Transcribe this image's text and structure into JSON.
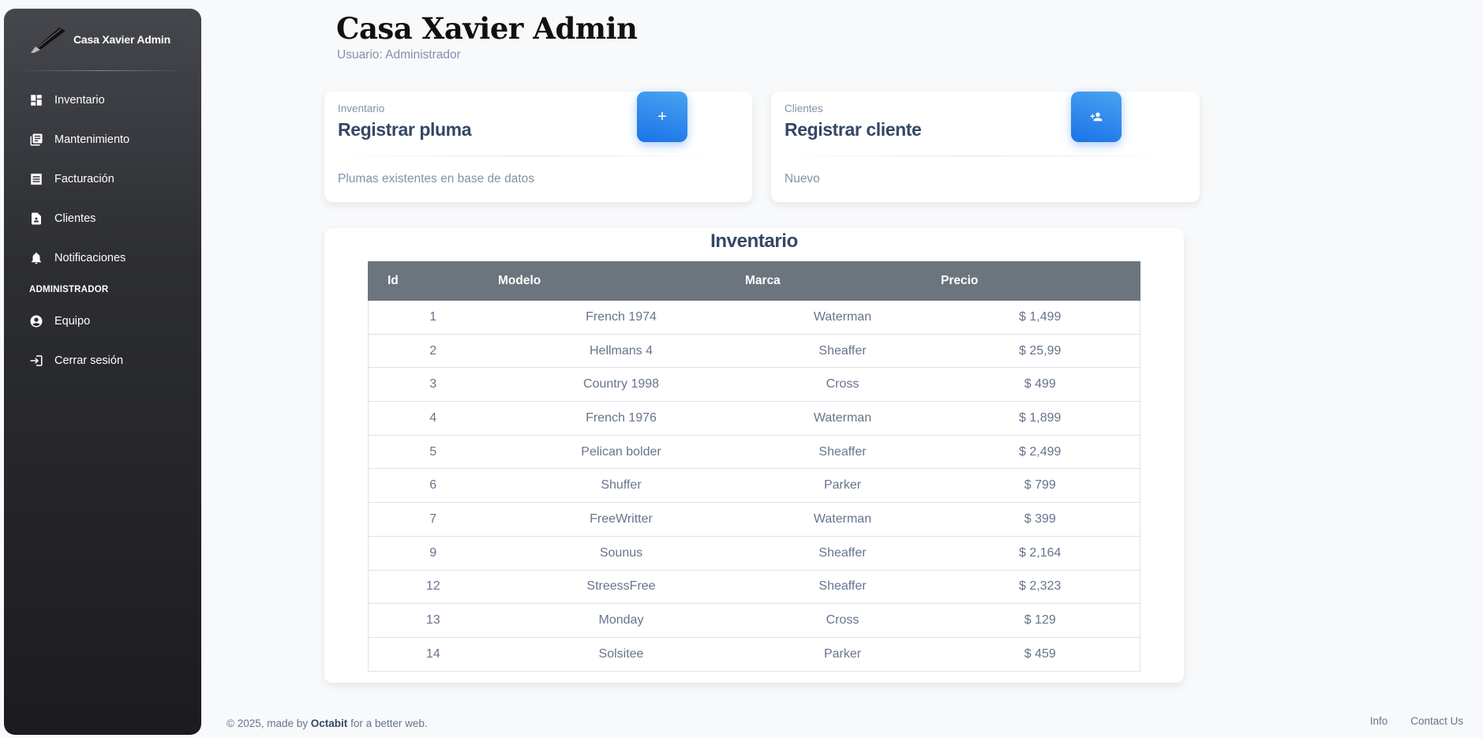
{
  "sidebar": {
    "brand": "Casa Xavier Admin",
    "items": [
      {
        "label": "Inventario",
        "icon": "dashboard-icon"
      },
      {
        "label": "Mantenimiento",
        "icon": "library-icon"
      },
      {
        "label": "Facturación",
        "icon": "receipt-icon"
      },
      {
        "label": "Clientes",
        "icon": "contact-page-icon"
      },
      {
        "label": "Notificaciones",
        "icon": "bell-icon"
      }
    ],
    "section": "ADMINISTRADOR",
    "admin_items": [
      {
        "label": "Equipo",
        "icon": "account-circle-icon"
      },
      {
        "label": "Cerrar sesión",
        "icon": "login-icon"
      }
    ]
  },
  "header": {
    "title": "Casa Xavier Admin",
    "subtitle": "Usuario: Administrador"
  },
  "cards": [
    {
      "label": "Inventario",
      "title": "Registrar pluma",
      "footer": "Plumas existentes en base de datos",
      "button_glyph": "+"
    },
    {
      "label": "Clientes",
      "title": "Registrar cliente",
      "footer": "Nuevo",
      "button_icon": "person-add-icon"
    }
  ],
  "inventory": {
    "title": "Inventario",
    "columns": [
      "Id",
      "Modelo",
      "Marca",
      "Precio"
    ],
    "rows": [
      [
        "1",
        "French 1974",
        "Waterman",
        "$ 1,499"
      ],
      [
        "2",
        "Hellmans 4",
        "Sheaffer",
        "$ 25,99"
      ],
      [
        "3",
        "Country 1998",
        "Cross",
        "$ 499"
      ],
      [
        "4",
        "French 1976",
        "Waterman",
        "$ 1,899"
      ],
      [
        "5",
        "Pelican bolder",
        "Sheaffer",
        "$ 2,499"
      ],
      [
        "6",
        "Shuffer",
        "Parker",
        "$ 799"
      ],
      [
        "7",
        "FreeWritter",
        "Waterman",
        "$ 399"
      ],
      [
        "9",
        "Sounus",
        "Sheaffer",
        "$ 2,164"
      ],
      [
        "12",
        "StreessFree",
        "Sheaffer",
        "$ 2,323"
      ],
      [
        "13",
        "Monday",
        "Cross",
        "$ 129"
      ],
      [
        "14",
        "Solsitee",
        "Parker",
        "$ 459"
      ]
    ]
  },
  "footer": {
    "copyright_prefix": "© 2025, made by",
    "brand": "Octabit",
    "copyright_suffix": "for a better web.",
    "links": [
      "Info",
      "Contact Us"
    ]
  },
  "colors": {
    "accent": "#1A73E8",
    "sidebar_dark": "#1c1c1e",
    "table_header": "#6c757d"
  }
}
